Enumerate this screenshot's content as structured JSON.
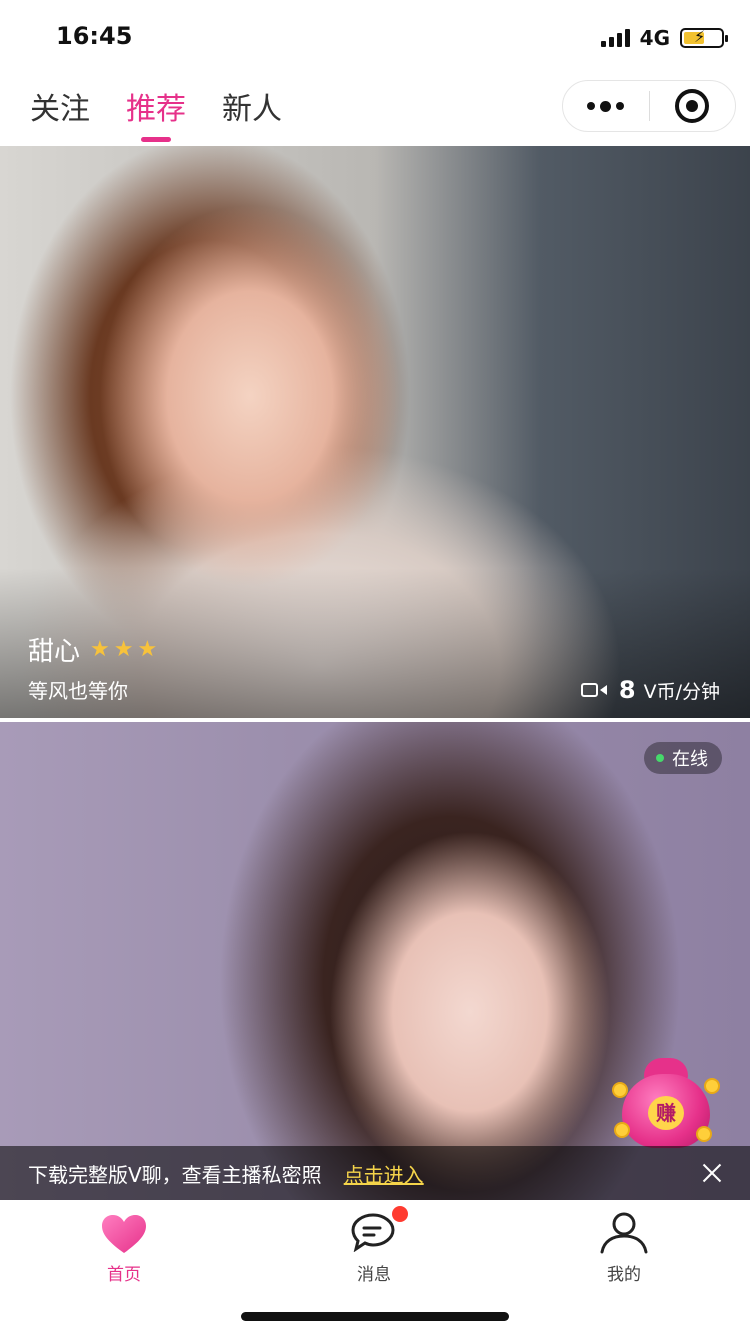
{
  "status_bar": {
    "time": "16:45",
    "network": "4G",
    "battery_level": 0.55,
    "battery_color": "#f2c230"
  },
  "top_nav": {
    "tabs": [
      {
        "label": "关注",
        "active": false
      },
      {
        "label": "推荐",
        "active": true
      },
      {
        "label": "新人",
        "active": false
      }
    ],
    "accent_color": "#e6318a",
    "capsule": {
      "more_icon": "more-dots-icon",
      "close_icon": "target-icon"
    }
  },
  "cards": [
    {
      "name": "甜心",
      "rating_stars": 3,
      "bio": "等风也等你",
      "price_value": "8",
      "price_unit": "V币/分钟",
      "call_icon": "video-camera-icon"
    },
    {
      "online_label": "在线",
      "online_color": "#46d96b"
    }
  ],
  "money_bag": {
    "label": "赚",
    "icon": "money-bag-icon"
  },
  "promo_banner": {
    "text": "下载完整版V聊，查看主播私密照",
    "link": "点击进入",
    "link_color": "#f5d44a"
  },
  "tabbar": {
    "items": [
      {
        "label": "首页",
        "icon": "heart-icon",
        "active": true
      },
      {
        "label": "消息",
        "icon": "message-icon",
        "has_badge": true
      },
      {
        "label": "我的",
        "icon": "person-icon"
      }
    ],
    "badge_color": "#ff3b30"
  }
}
